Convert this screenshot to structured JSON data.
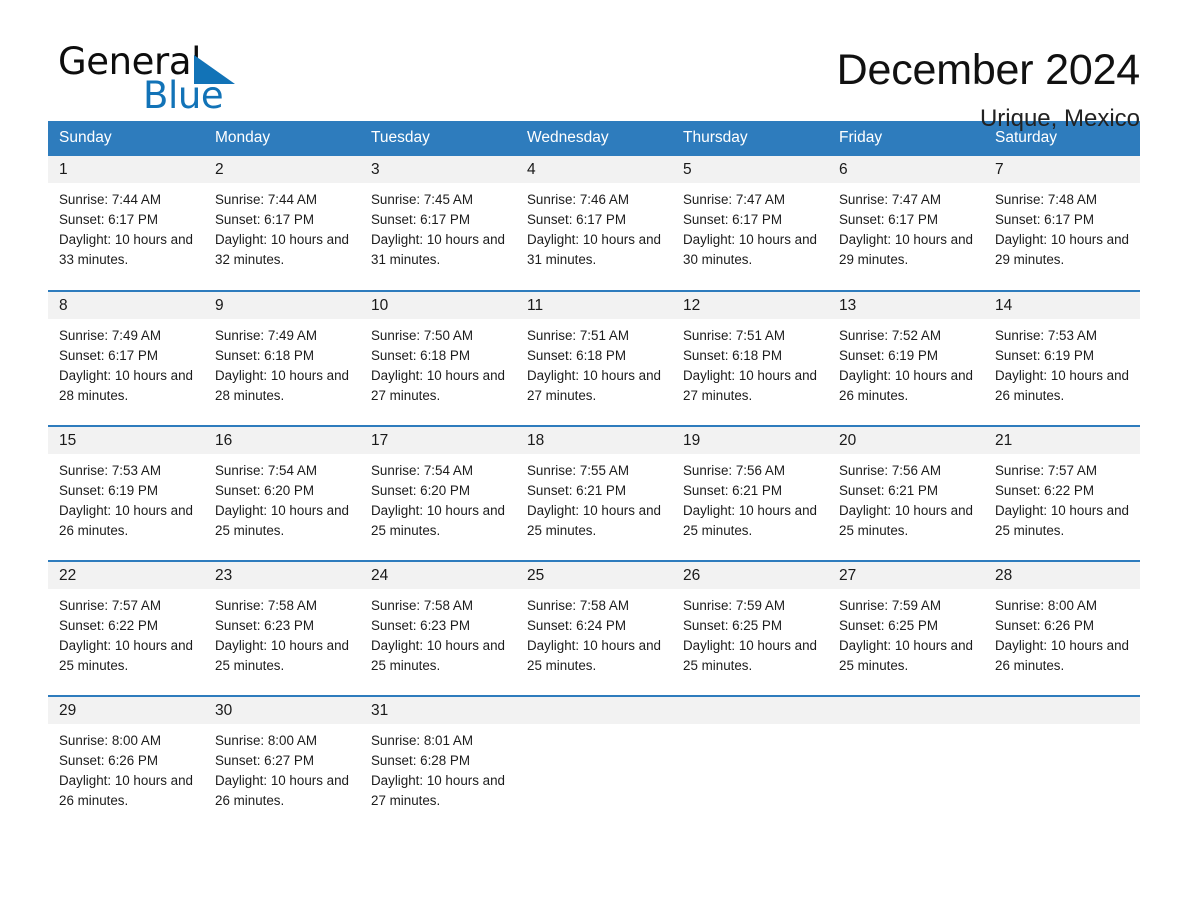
{
  "brand": {
    "name_part1": "General",
    "name_part2": "Blue",
    "triangle_color": "#1273b7"
  },
  "header": {
    "title": "December 2024",
    "subtitle": "Urique, Mexico",
    "accent_color": "#2e7cbd"
  },
  "calendar": {
    "weekdays": [
      "Sunday",
      "Monday",
      "Tuesday",
      "Wednesday",
      "Thursday",
      "Friday",
      "Saturday"
    ],
    "weeks": [
      [
        {
          "day": "1",
          "sunrise": "Sunrise: 7:44 AM",
          "sunset": "Sunset: 6:17 PM",
          "daylight": "Daylight: 10 hours and 33 minutes."
        },
        {
          "day": "2",
          "sunrise": "Sunrise: 7:44 AM",
          "sunset": "Sunset: 6:17 PM",
          "daylight": "Daylight: 10 hours and 32 minutes."
        },
        {
          "day": "3",
          "sunrise": "Sunrise: 7:45 AM",
          "sunset": "Sunset: 6:17 PM",
          "daylight": "Daylight: 10 hours and 31 minutes."
        },
        {
          "day": "4",
          "sunrise": "Sunrise: 7:46 AM",
          "sunset": "Sunset: 6:17 PM",
          "daylight": "Daylight: 10 hours and 31 minutes."
        },
        {
          "day": "5",
          "sunrise": "Sunrise: 7:47 AM",
          "sunset": "Sunset: 6:17 PM",
          "daylight": "Daylight: 10 hours and 30 minutes."
        },
        {
          "day": "6",
          "sunrise": "Sunrise: 7:47 AM",
          "sunset": "Sunset: 6:17 PM",
          "daylight": "Daylight: 10 hours and 29 minutes."
        },
        {
          "day": "7",
          "sunrise": "Sunrise: 7:48 AM",
          "sunset": "Sunset: 6:17 PM",
          "daylight": "Daylight: 10 hours and 29 minutes."
        }
      ],
      [
        {
          "day": "8",
          "sunrise": "Sunrise: 7:49 AM",
          "sunset": "Sunset: 6:17 PM",
          "daylight": "Daylight: 10 hours and 28 minutes."
        },
        {
          "day": "9",
          "sunrise": "Sunrise: 7:49 AM",
          "sunset": "Sunset: 6:18 PM",
          "daylight": "Daylight: 10 hours and 28 minutes."
        },
        {
          "day": "10",
          "sunrise": "Sunrise: 7:50 AM",
          "sunset": "Sunset: 6:18 PM",
          "daylight": "Daylight: 10 hours and 27 minutes."
        },
        {
          "day": "11",
          "sunrise": "Sunrise: 7:51 AM",
          "sunset": "Sunset: 6:18 PM",
          "daylight": "Daylight: 10 hours and 27 minutes."
        },
        {
          "day": "12",
          "sunrise": "Sunrise: 7:51 AM",
          "sunset": "Sunset: 6:18 PM",
          "daylight": "Daylight: 10 hours and 27 minutes."
        },
        {
          "day": "13",
          "sunrise": "Sunrise: 7:52 AM",
          "sunset": "Sunset: 6:19 PM",
          "daylight": "Daylight: 10 hours and 26 minutes."
        },
        {
          "day": "14",
          "sunrise": "Sunrise: 7:53 AM",
          "sunset": "Sunset: 6:19 PM",
          "daylight": "Daylight: 10 hours and 26 minutes."
        }
      ],
      [
        {
          "day": "15",
          "sunrise": "Sunrise: 7:53 AM",
          "sunset": "Sunset: 6:19 PM",
          "daylight": "Daylight: 10 hours and 26 minutes."
        },
        {
          "day": "16",
          "sunrise": "Sunrise: 7:54 AM",
          "sunset": "Sunset: 6:20 PM",
          "daylight": "Daylight: 10 hours and 25 minutes."
        },
        {
          "day": "17",
          "sunrise": "Sunrise: 7:54 AM",
          "sunset": "Sunset: 6:20 PM",
          "daylight": "Daylight: 10 hours and 25 minutes."
        },
        {
          "day": "18",
          "sunrise": "Sunrise: 7:55 AM",
          "sunset": "Sunset: 6:21 PM",
          "daylight": "Daylight: 10 hours and 25 minutes."
        },
        {
          "day": "19",
          "sunrise": "Sunrise: 7:56 AM",
          "sunset": "Sunset: 6:21 PM",
          "daylight": "Daylight: 10 hours and 25 minutes."
        },
        {
          "day": "20",
          "sunrise": "Sunrise: 7:56 AM",
          "sunset": "Sunset: 6:21 PM",
          "daylight": "Daylight: 10 hours and 25 minutes."
        },
        {
          "day": "21",
          "sunrise": "Sunrise: 7:57 AM",
          "sunset": "Sunset: 6:22 PM",
          "daylight": "Daylight: 10 hours and 25 minutes."
        }
      ],
      [
        {
          "day": "22",
          "sunrise": "Sunrise: 7:57 AM",
          "sunset": "Sunset: 6:22 PM",
          "daylight": "Daylight: 10 hours and 25 minutes."
        },
        {
          "day": "23",
          "sunrise": "Sunrise: 7:58 AM",
          "sunset": "Sunset: 6:23 PM",
          "daylight": "Daylight: 10 hours and 25 minutes."
        },
        {
          "day": "24",
          "sunrise": "Sunrise: 7:58 AM",
          "sunset": "Sunset: 6:23 PM",
          "daylight": "Daylight: 10 hours and 25 minutes."
        },
        {
          "day": "25",
          "sunrise": "Sunrise: 7:58 AM",
          "sunset": "Sunset: 6:24 PM",
          "daylight": "Daylight: 10 hours and 25 minutes."
        },
        {
          "day": "26",
          "sunrise": "Sunrise: 7:59 AM",
          "sunset": "Sunset: 6:25 PM",
          "daylight": "Daylight: 10 hours and 25 minutes."
        },
        {
          "day": "27",
          "sunrise": "Sunrise: 7:59 AM",
          "sunset": "Sunset: 6:25 PM",
          "daylight": "Daylight: 10 hours and 25 minutes."
        },
        {
          "day": "28",
          "sunrise": "Sunrise: 8:00 AM",
          "sunset": "Sunset: 6:26 PM",
          "daylight": "Daylight: 10 hours and 26 minutes."
        }
      ],
      [
        {
          "day": "29",
          "sunrise": "Sunrise: 8:00 AM",
          "sunset": "Sunset: 6:26 PM",
          "daylight": "Daylight: 10 hours and 26 minutes."
        },
        {
          "day": "30",
          "sunrise": "Sunrise: 8:00 AM",
          "sunset": "Sunset: 6:27 PM",
          "daylight": "Daylight: 10 hours and 26 minutes."
        },
        {
          "day": "31",
          "sunrise": "Sunrise: 8:01 AM",
          "sunset": "Sunset: 6:28 PM",
          "daylight": "Daylight: 10 hours and 27 minutes."
        },
        {
          "day": "",
          "sunrise": "",
          "sunset": "",
          "daylight": ""
        },
        {
          "day": "",
          "sunrise": "",
          "sunset": "",
          "daylight": ""
        },
        {
          "day": "",
          "sunrise": "",
          "sunset": "",
          "daylight": ""
        },
        {
          "day": "",
          "sunrise": "",
          "sunset": "",
          "daylight": ""
        }
      ]
    ]
  }
}
